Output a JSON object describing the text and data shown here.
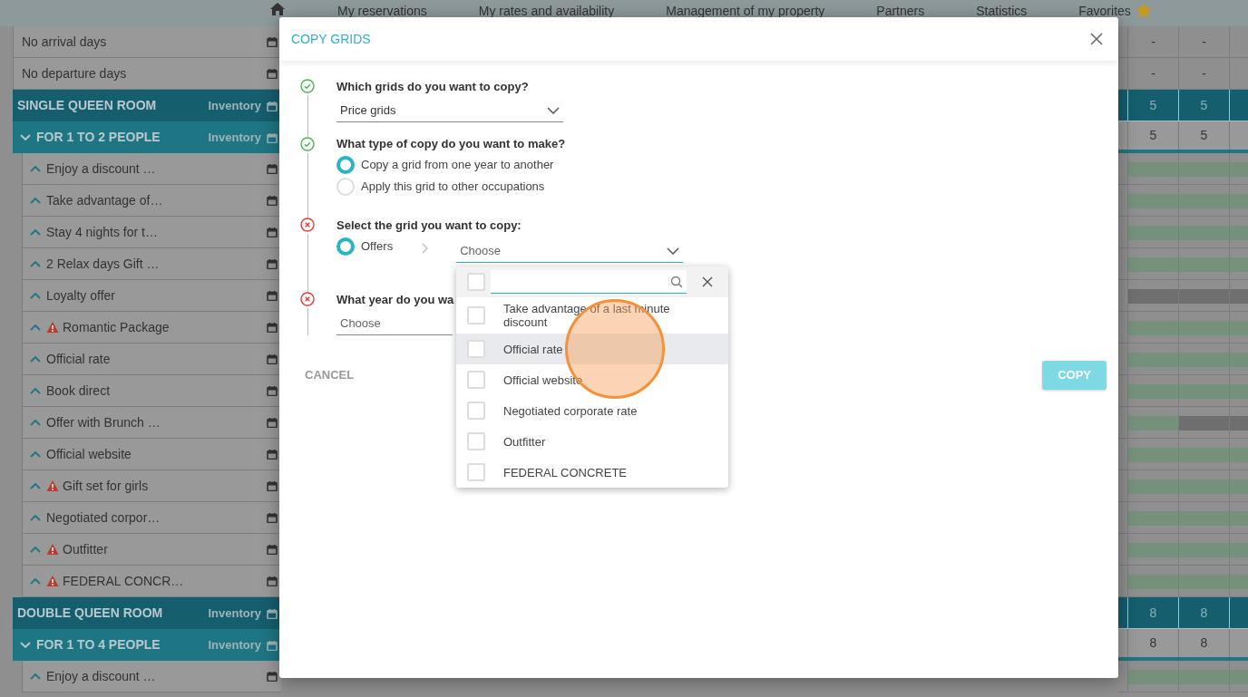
{
  "nav": {
    "items": [
      {
        "label": "My reservations"
      },
      {
        "label": "My rates and availability"
      },
      {
        "label": "Management of my property"
      },
      {
        "label": "Partners"
      },
      {
        "label": "Statistics"
      },
      {
        "label": "Favorites"
      }
    ]
  },
  "rows": [
    {
      "kind": "plain",
      "label": "No arrival days",
      "cells": [
        "-",
        "-"
      ]
    },
    {
      "kind": "plain",
      "label": "No departure days",
      "cells": [
        "-",
        "-"
      ]
    },
    {
      "kind": "room",
      "label": "SINGLE QUEEN ROOM",
      "tag": "Inventory",
      "cells": [
        "5",
        "5"
      ]
    },
    {
      "kind": "occupancy",
      "label": "FOR 1 TO 2 PEOPLE",
      "tag": "Inventory",
      "expanded": true,
      "cells": [
        "5",
        "5"
      ]
    },
    {
      "kind": "offer",
      "label": "Enjoy a discount …",
      "expanded": false,
      "warning": false,
      "availability": [
        true,
        true,
        true
      ]
    },
    {
      "kind": "offer",
      "label": "Take advantage of…",
      "expanded": false,
      "warning": false,
      "availability": [
        true,
        true,
        true
      ]
    },
    {
      "kind": "offer",
      "label": "Stay 4 nights for t…",
      "expanded": false,
      "warning": false,
      "availability": [
        true,
        true,
        true
      ]
    },
    {
      "kind": "offer",
      "label": "2 Relax days Gift …",
      "expanded": false,
      "warning": false,
      "availability": [
        true,
        true,
        true
      ]
    },
    {
      "kind": "offer",
      "label": "Loyalty offer",
      "expanded": false,
      "warning": false,
      "availability": [
        false,
        false,
        false
      ]
    },
    {
      "kind": "offer",
      "label": "Romantic Package",
      "expanded": false,
      "warning": true,
      "availability": [
        true,
        true,
        true
      ]
    },
    {
      "kind": "offer",
      "label": "Official rate",
      "expanded": false,
      "warning": false,
      "availability": [
        true,
        true,
        true
      ]
    },
    {
      "kind": "offer",
      "label": "Book direct",
      "expanded": false,
      "warning": false,
      "availability": [
        true,
        true,
        true
      ]
    },
    {
      "kind": "offer",
      "label": "Offer with Brunch …",
      "expanded": false,
      "warning": false,
      "availability": [
        true,
        false,
        false
      ]
    },
    {
      "kind": "offer",
      "label": "Official website",
      "expanded": false,
      "warning": false,
      "availability": [
        true,
        true,
        true
      ]
    },
    {
      "kind": "offer",
      "label": "Gift set for girls",
      "expanded": false,
      "warning": true,
      "availability": [
        true,
        true,
        true
      ]
    },
    {
      "kind": "offer",
      "label": "Negotiated corpor…",
      "expanded": false,
      "warning": false,
      "availability": [
        true,
        true,
        true
      ]
    },
    {
      "kind": "offer",
      "label": "Outfitter",
      "expanded": false,
      "warning": true,
      "availability": [
        true,
        true,
        true
      ]
    },
    {
      "kind": "offer",
      "label": "FEDERAL CONCR…",
      "expanded": false,
      "warning": true,
      "availability": [
        true,
        true,
        true
      ]
    },
    {
      "kind": "room",
      "label": "DOUBLE QUEEN ROOM",
      "tag": "Inventory",
      "cells": [
        "8",
        "8"
      ]
    },
    {
      "kind": "occupancy",
      "label": "FOR 1 TO 4 PEOPLE",
      "tag": "Inventory",
      "expanded": true,
      "cells": [
        "8",
        "8"
      ]
    },
    {
      "kind": "offer",
      "label": "Enjoy a discount …",
      "expanded": false,
      "warning": false,
      "availability": [
        true,
        true,
        true
      ]
    }
  ],
  "dialog": {
    "title": "COPY GRIDS",
    "steps": [
      {
        "complete": true,
        "kind": "select",
        "question": "Which grids do you want to copy?",
        "value": "Price grids"
      },
      {
        "complete": true,
        "kind": "radios",
        "question": "What type of copy do you want to make?",
        "options": [
          {
            "label": "Copy a grid from one year to another",
            "selected": true
          },
          {
            "label": "Apply this grid to other occupations",
            "selected": false
          }
        ]
      },
      {
        "complete": false,
        "kind": "source",
        "question": "Select the grid you want to copy:",
        "options": [
          {
            "label": "Offers",
            "selected": true
          }
        ],
        "select": {
          "placeholder": "Choose",
          "open": true
        }
      },
      {
        "complete": false,
        "kind": "select",
        "question": "What year do you wa",
        "placeholder": "Choose"
      }
    ],
    "dropdown": {
      "all_checked": false,
      "items": [
        {
          "label": "Take advantage of a last minute discount",
          "checked": false,
          "highlighted": false
        },
        {
          "label": "Official rate",
          "checked": false,
          "highlighted": true
        },
        {
          "label": "Official website",
          "checked": false,
          "highlighted": false
        },
        {
          "label": "Negotiated corporate rate",
          "checked": false,
          "highlighted": false
        },
        {
          "label": "Outfitter",
          "checked": false,
          "highlighted": false
        },
        {
          "label": "FEDERAL CONCRETE",
          "checked": false,
          "highlighted": false
        }
      ]
    },
    "cancel": "CANCEL",
    "copy": {
      "label": "COPY",
      "disabled": true
    }
  }
}
